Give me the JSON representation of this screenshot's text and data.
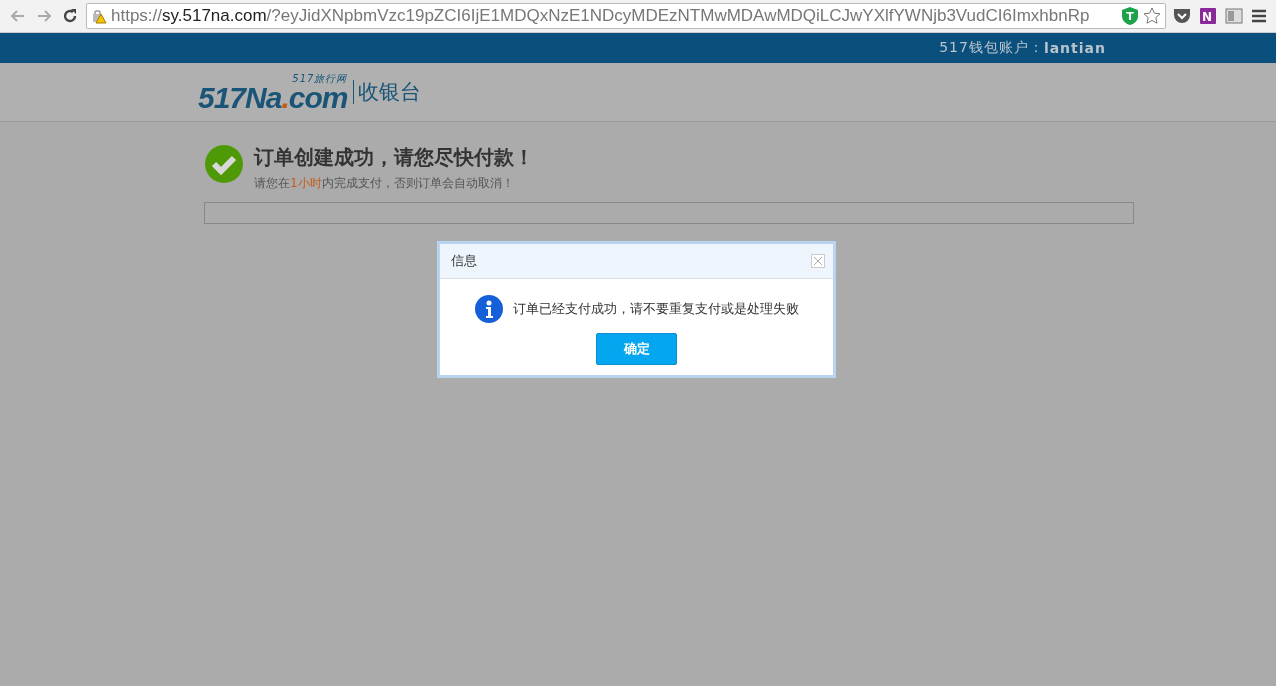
{
  "browser": {
    "url_scheme": "https://",
    "url_host": "sy.517na.com",
    "url_rest": "/?eyJidXNpbmVzc19pZCI6IjE1MDQxNzE1NDcyMDEzNTMwMDAwMDQiLCJwYXlfYWNjb3VudCI6ImxhbnRp",
    "extension_letter": "T",
    "onenote_letter": "N"
  },
  "top_bar": {
    "account_label": "517钱包账户：",
    "account_name": "lantian"
  },
  "header": {
    "logo_main": "517Na",
    "logo_dot": ".",
    "logo_domain": "com",
    "logo_tagline": "517旅行网",
    "section": "收银台"
  },
  "order": {
    "title": "订单创建成功，请您尽快付款！",
    "notice_before": "请您在",
    "notice_highlight": "1小时",
    "notice_after": "内完成支付，否则订单会自动取消！"
  },
  "dialog": {
    "title": "信息",
    "message": "订单已经支付成功，请不要重复支付或是处理失败",
    "button": "确定"
  }
}
